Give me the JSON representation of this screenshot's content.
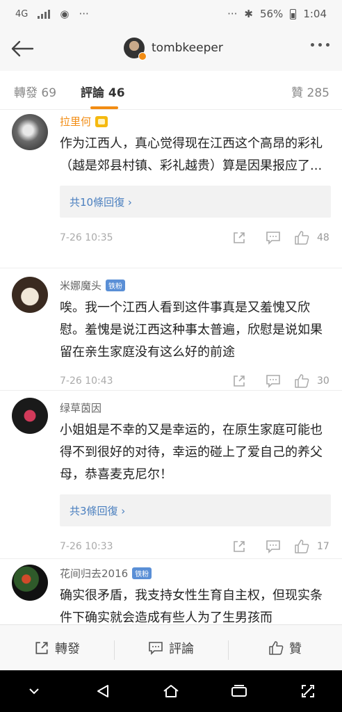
{
  "status_bar": {
    "network": "4G",
    "dots": "···",
    "dots_right": "···",
    "battery": "56%",
    "time": "1:04"
  },
  "header": {
    "title": "tombkeeper"
  },
  "tabs": [
    {
      "label": "轉發 69"
    },
    {
      "label": "評論 46"
    },
    {
      "label": "贊 285"
    }
  ],
  "comments": [
    {
      "name": "拉里何",
      "text": "作为江西人，真心觉得现在江西这个高昂的彩礼（越是郊县村镇、彩礼越贵）算是因果报应了...",
      "reply_link": "共10條回復 ›",
      "time": "7-26 10:35",
      "likes": "48"
    },
    {
      "name": "米娜魔头",
      "badge": "铁粉",
      "text": "唉。我一个江西人看到这件事真是又羞愧又欣慰。羞愧是说江西这种事太普遍，欣慰是说如果留在亲生家庭没有这么好的前途",
      "time": "7-26 10:43",
      "likes": "30"
    },
    {
      "name": "绿草茵因",
      "text": "小姐姐是不幸的又是幸运的，在原生家庭可能也得不到很好的对待，幸运的碰上了爱自己的养父母，恭喜麦克尼尔！",
      "reply_link": "共3條回復 ›",
      "time": "7-26 10:33",
      "likes": "17"
    },
    {
      "name": "花间归去2016",
      "badge": "铁粉",
      "text": "确实很矛盾，我支持女性生育自主权，但现实条件下确实就会造成有些人为了生男孩而"
    }
  ],
  "actions": {
    "repost": "轉發",
    "comment": "評論",
    "like": "贊"
  },
  "colors": {
    "accent": "#f28c13",
    "link": "#4a7fbf",
    "badge": "#5a8fd6"
  }
}
